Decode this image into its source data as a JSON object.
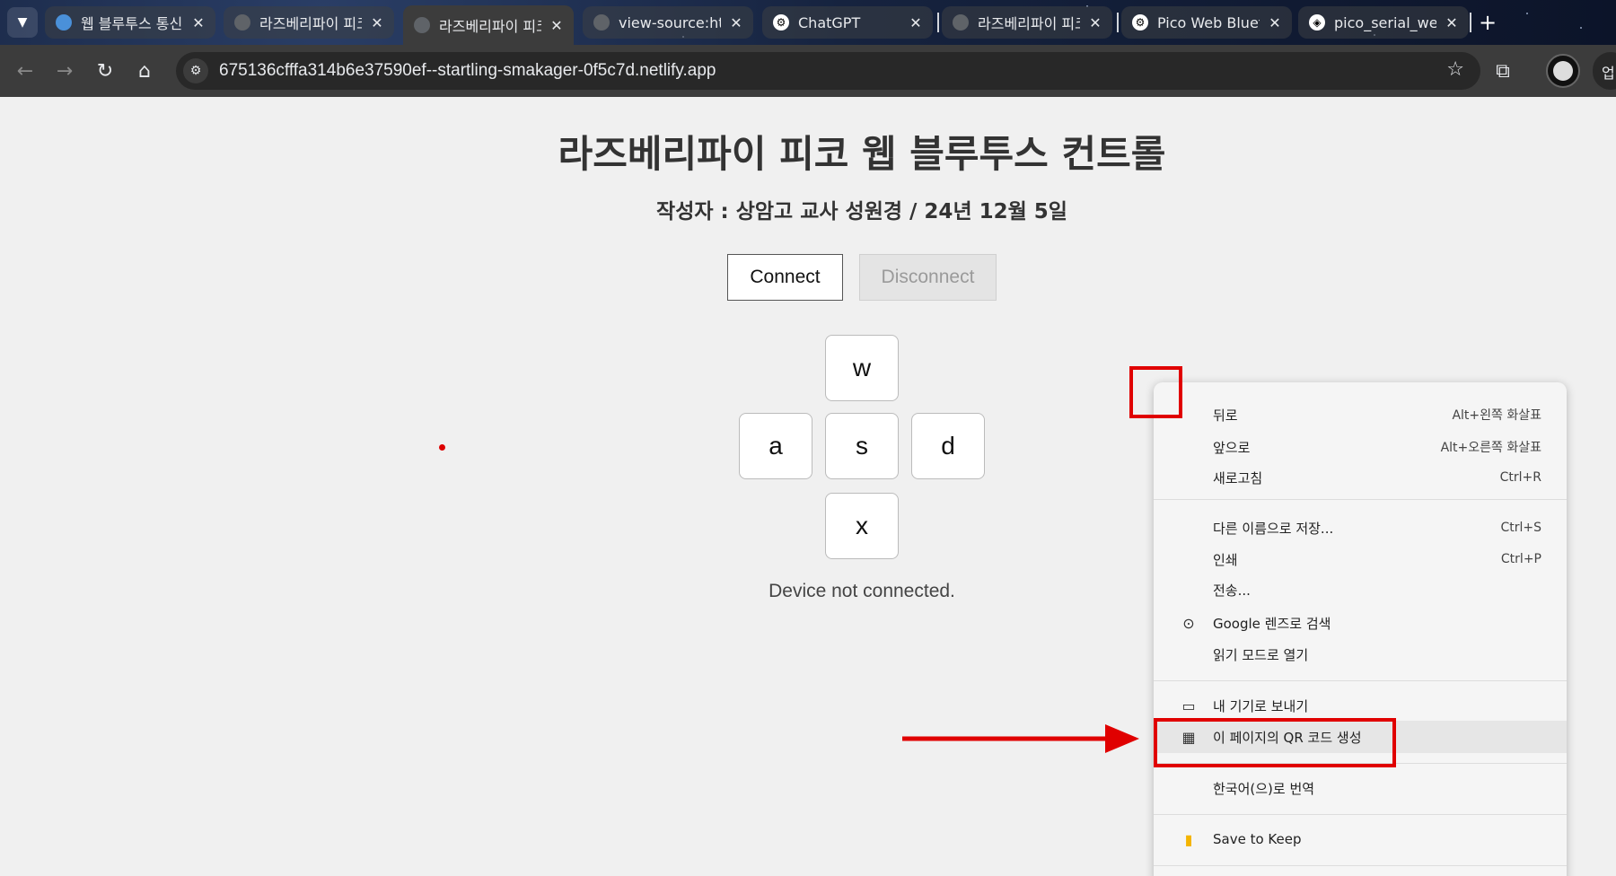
{
  "tabs": [
    {
      "title": "웹 블루투스 통신",
      "favicon": "bluetooth-globe-icon",
      "active": false
    },
    {
      "title": "라즈베리파이 피코",
      "favicon": "globe-icon",
      "active": false
    },
    {
      "title": "라즈베리파이 피코",
      "favicon": "globe-icon",
      "active": true
    },
    {
      "title": "view-source:https",
      "favicon": "globe-icon",
      "active": false
    },
    {
      "title": "ChatGPT",
      "favicon": "chatgpt-icon",
      "active": false
    },
    {
      "title": "라즈베리파이 피코",
      "favicon": "globe-icon",
      "active": false
    },
    {
      "title": "Pico Web Bluetooth",
      "favicon": "chatgpt-icon",
      "active": false
    },
    {
      "title": "pico_serial_web",
      "favicon": "codepen-icon",
      "active": false
    }
  ],
  "toolbar": {
    "url": "675136cfffa314b6e37590ef--startling-smakager-0f5c7d.netlify.app",
    "profile_clip": "업"
  },
  "page": {
    "title": "라즈베리파이 피코 웹 블루투스 컨트롤",
    "subtitle": "작성자 : 상암고 교사 성원경 / 24년 12월 5일",
    "connect_label": "Connect",
    "disconnect_label": "Disconnect",
    "keys": {
      "w": "w",
      "a": "a",
      "s": "s",
      "d": "d",
      "x": "x"
    },
    "status": "Device not connected."
  },
  "context_menu": {
    "items": [
      {
        "label": "뒤로",
        "shortcut": "Alt+왼쪽 화살표"
      },
      {
        "label": "앞으로",
        "shortcut": "Alt+오른쪽 화살표"
      },
      {
        "label": "새로고침",
        "shortcut": "Ctrl+R"
      },
      {
        "label": "다른 이름으로 저장...",
        "shortcut": "Ctrl+S"
      },
      {
        "label": "인쇄",
        "shortcut": "Ctrl+P"
      },
      {
        "label": "전송..."
      },
      {
        "label": "Google 렌즈로 검색",
        "icon": "lens-icon"
      },
      {
        "label": "읽기 모드로 열기"
      },
      {
        "label": "내 기기로 보내기",
        "icon": "devices-icon"
      },
      {
        "label": "이 페이지의 QR 코드 생성",
        "icon": "qr-code-icon",
        "highlighted": true
      },
      {
        "label": "한국어(으)로 번역"
      },
      {
        "label": "Save to Keep",
        "icon": "keep-icon"
      }
    ]
  },
  "colors": {
    "annotation": "#e00000",
    "toolbar": "#3c3c3c",
    "page_bg": "#f0f0f0"
  }
}
